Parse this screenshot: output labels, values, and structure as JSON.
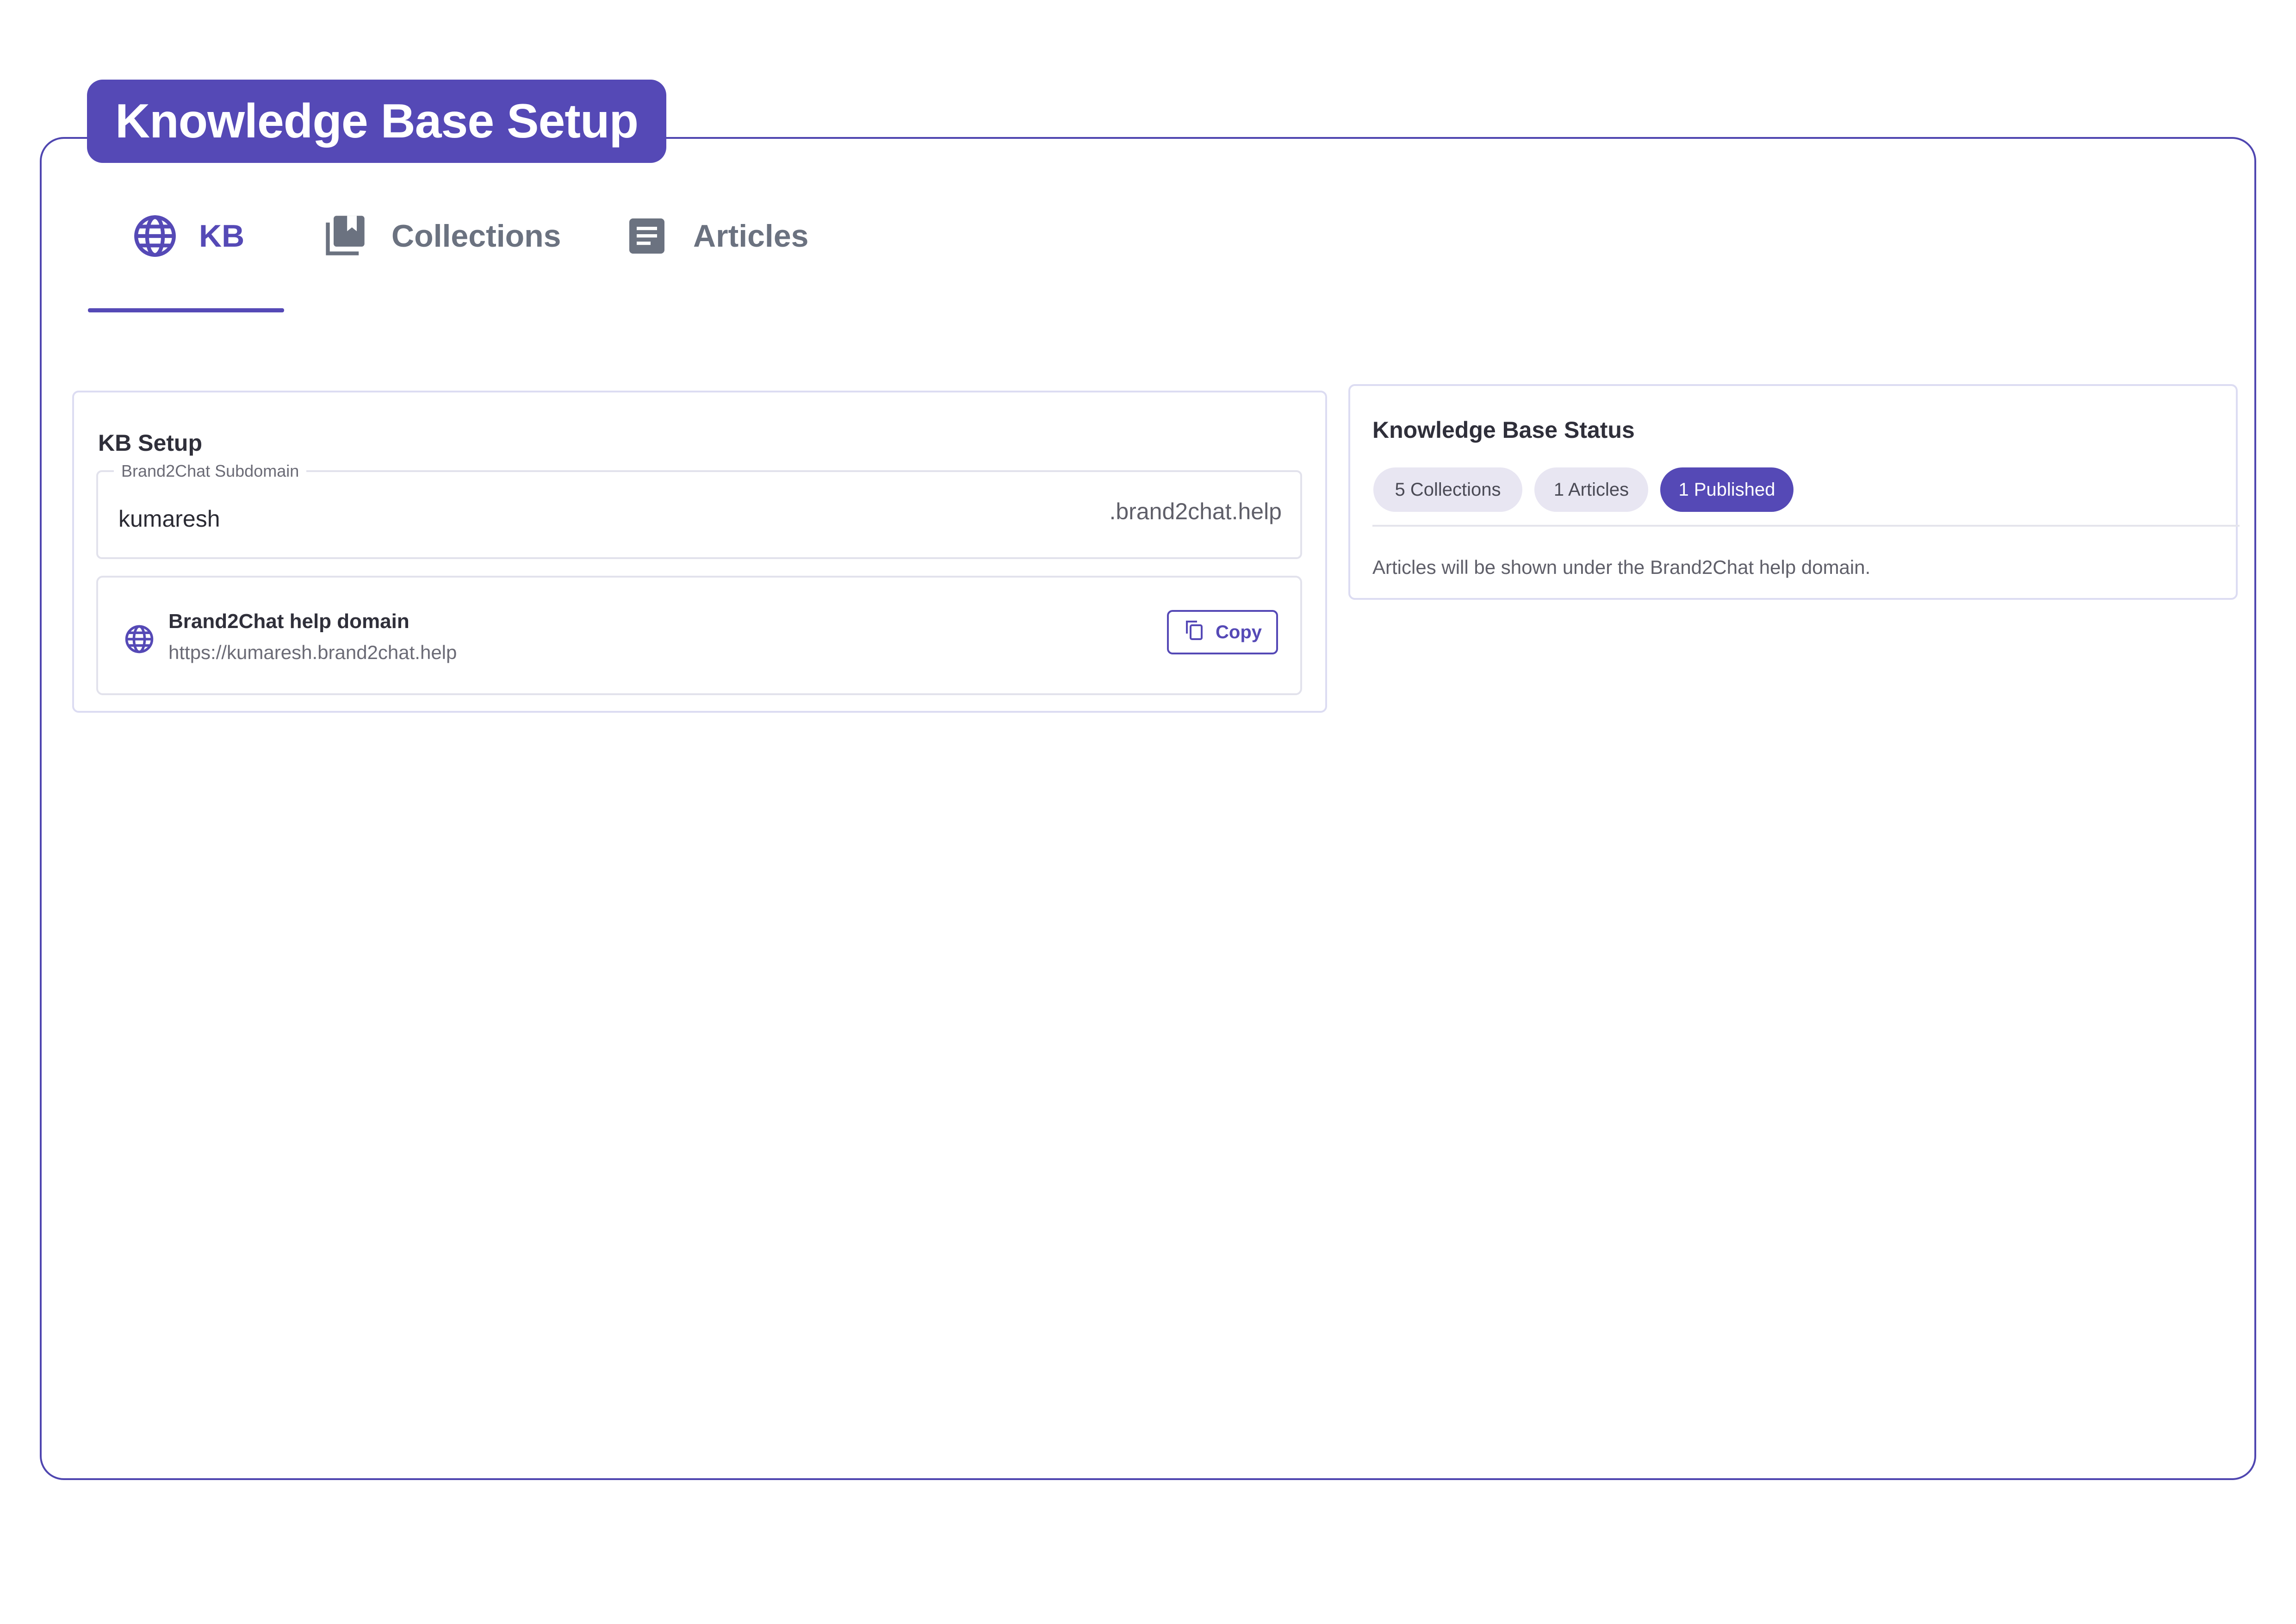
{
  "header": {
    "title": "Knowledge Base Setup"
  },
  "tabs": [
    {
      "label": "KB",
      "icon": "globe-icon",
      "active": true
    },
    {
      "label": "Collections",
      "icon": "library-books-icon",
      "active": false
    },
    {
      "label": "Articles",
      "icon": "article-icon",
      "active": false
    }
  ],
  "kb_setup": {
    "title": "KB Setup",
    "subdomain_label": "Brand2Chat Subdomain",
    "subdomain_value": "kumaresh",
    "subdomain_suffix": ".brand2chat.help",
    "domain": {
      "icon": "globe-icon",
      "title": "Brand2Chat help domain",
      "url": "https://kumaresh.brand2chat.help",
      "copy_label": "Copy",
      "copy_icon": "copy-icon"
    }
  },
  "status": {
    "title": "Knowledge Base Status",
    "pills": [
      "5 Collections",
      "1 Articles",
      "1 Published"
    ],
    "note": "Articles will be shown under the Brand2Chat help domain."
  },
  "colors": {
    "primary": "#5549b6",
    "border": "#4f46b0",
    "pill_bg": "#e8e6f2",
    "muted_text": "#6b7280"
  }
}
